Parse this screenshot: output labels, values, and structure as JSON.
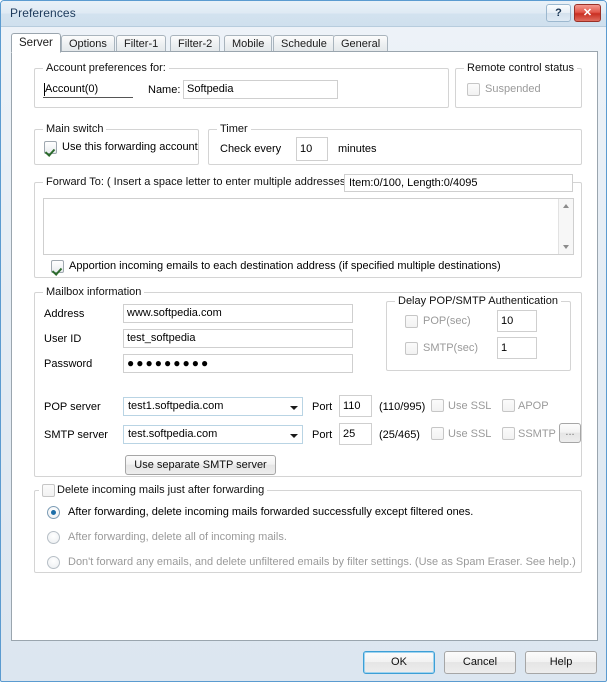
{
  "window": {
    "title": "Preferences",
    "help_button": "?",
    "close_button": "✕"
  },
  "tabs": [
    {
      "label": "Server",
      "active": true
    },
    {
      "label": "Options",
      "active": false
    },
    {
      "label": "Filter-1",
      "active": false
    },
    {
      "label": "Filter-2",
      "active": false
    },
    {
      "label": "Mobile",
      "active": false
    },
    {
      "label": "Schedule",
      "active": false
    },
    {
      "label": "General",
      "active": false
    }
  ],
  "account_group": {
    "legend": "Account preferences for:",
    "account_value": "Account(0)",
    "name_label": "Name:",
    "name_value": "Softpedia"
  },
  "remote_control": {
    "legend": "Remote control status",
    "suspended_label": "Suspended",
    "suspended_checked": false
  },
  "main_switch": {
    "legend": "Main switch",
    "use_account_label": "Use this forwarding account",
    "use_account_checked": true
  },
  "timer": {
    "legend": "Timer",
    "check_every_label": "Check every",
    "interval_value": "10",
    "minutes_label": "minutes"
  },
  "forward_to": {
    "legend": "Forward To: ( Insert a space letter to enter multiple addresses.)",
    "counter": "Item:0/100,  Length:0/4095",
    "textarea_value": "",
    "apportion_label": "Apportion incoming emails to each destination address (if specified multiple destinations)",
    "apportion_checked": true
  },
  "mailbox": {
    "legend": "Mailbox information",
    "address_label": "Address",
    "address_value": "www.softpedia.com",
    "userid_label": "User ID",
    "userid_value": "test_softpedia",
    "password_label": "Password",
    "password_value": "●●●●●●●●●",
    "pop_server_label": "POP server",
    "pop_server_value": "test1.softpedia.com",
    "pop_port_label": "Port",
    "pop_port_value": "110",
    "pop_port_hint": "(110/995)",
    "pop_ssl_label": "Use SSL",
    "pop_ssl_checked": false,
    "apop_label": "APOP",
    "apop_checked": false,
    "smtp_server_label": "SMTP server",
    "smtp_server_value": "test.softpedia.com",
    "smtp_port_label": "Port",
    "smtp_port_value": "25",
    "smtp_port_hint": "(25/465)",
    "smtp_ssl_label": "Use SSL",
    "smtp_ssl_checked": false,
    "ssmtp_label": "SSMTP",
    "ssmtp_checked": false,
    "browse_button": "...",
    "separate_smtp_button": "Use separate SMTP server"
  },
  "delay_auth": {
    "legend": "Delay POP/SMTP Authentication",
    "pop_label": "POP(sec)",
    "pop_checked": false,
    "pop_value": "10",
    "smtp_label": "SMTP(sec)",
    "smtp_checked": false,
    "smtp_value": "1"
  },
  "delete_group": {
    "legend": "Delete incoming mails just after forwarding",
    "legend_checked": false,
    "options": [
      {
        "label": "After forwarding, delete incoming mails forwarded successfully except filtered ones.",
        "selected": true
      },
      {
        "label": "After forwarding, delete all of incoming mails.",
        "selected": false
      },
      {
        "label": "Don't forward any emails, and delete unfiltered emails by filter settings. (Use as Spam Eraser. See help.)",
        "selected": false
      }
    ]
  },
  "footer": {
    "ok": "OK",
    "cancel": "Cancel",
    "help": "Help"
  },
  "colors": {
    "window_border": "#5b9bd0",
    "close_button": "#c92f22",
    "default_button_outline": "#3c9fd6",
    "radio_dot": "#1d6ea8",
    "check_mark": "#2c6b2c"
  }
}
